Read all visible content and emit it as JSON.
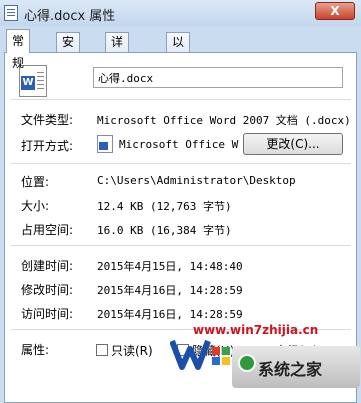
{
  "window": {
    "title": "心得.docx 属性",
    "close_label": "X"
  },
  "tabs": [
    {
      "label": "常规",
      "active": true
    },
    {
      "label": "安全"
    },
    {
      "label": "详细信息"
    },
    {
      "label": "以前的版本"
    }
  ],
  "general": {
    "filename": "心得.docx",
    "file_type_label": "文件类型:",
    "file_type_value": "Microsoft Office Word 2007 文档 (.docx)",
    "open_with_label": "打开方式:",
    "open_with_value": "Microsoft Office Wo",
    "change_button": "更改(C)...",
    "location_label": "位置:",
    "location_value": "C:\\Users\\Administrator\\Desktop",
    "size_label": "大小:",
    "size_value": "12.4 KB (12,763 字节)",
    "disk_size_label": "占用空间:",
    "disk_size_value": "16.0 KB (16,384 字节)",
    "created_label": "创建时间:",
    "created_value": "2015年4月15日, 14:48:40",
    "modified_label": "修改时间:",
    "modified_value": "2015年4月16日, 14:28:59",
    "accessed_label": "访问时间:",
    "accessed_value": "2015年4月16日, 14:28:59",
    "attributes_label": "属性:",
    "readonly_label": "只读(R)",
    "hidden_label": "隐藏(H)",
    "advanced_label": "高级(D)..."
  },
  "watermark": {
    "url": "www.win7zhijia.cn",
    "brand": "系统之家"
  }
}
